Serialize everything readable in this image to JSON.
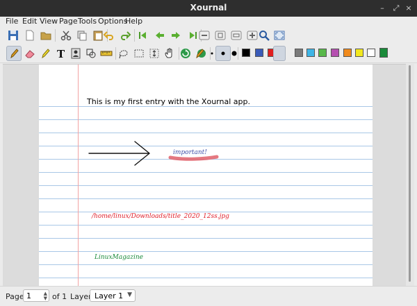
{
  "window": {
    "title": "Xournal",
    "minimize": "–",
    "restore": "⤢",
    "close": "×"
  },
  "menu": [
    "File",
    "Edit",
    "View",
    "Page",
    "Tools",
    "Options",
    "Help"
  ],
  "toolbar1": [
    "save-icon",
    "new-page-icon",
    "open-icon",
    "cut-icon",
    "copy-icon",
    "paste-icon",
    "undo-icon",
    "redo-icon",
    "first-page-icon",
    "previous-page-icon",
    "next-page-icon",
    "last-page-icon",
    "zoom-out-icon",
    "zoom-100-icon",
    "zoom-fit-icon",
    "zoom-in-icon",
    "search-icon",
    "fullscreen-icon"
  ],
  "toolbar2": [
    "pen-icon",
    "eraser-icon",
    "highlighter-icon",
    "text-icon",
    "image-icon",
    "shape-recognizer-icon",
    "ruler-icon",
    "select-region-icon",
    "select-rectangle-icon",
    "vertical-space-icon",
    "hand-icon",
    "default-tool-icon",
    "default-pen-icon"
  ],
  "thickness": [
    "fine",
    "medium",
    "thick"
  ],
  "colors": [
    "#000000",
    "#3a5bb8",
    "#e02020",
    "#1a8a3a",
    "#7a7a7a",
    "#3fb5e6",
    "#59b84a",
    "#b54fb0",
    "#f08a1c",
    "#f2e81e",
    "#ffffff",
    "#1a8a3a"
  ],
  "active_color": "#1a8a3a",
  "document": {
    "typed_text": "This is my first entry with the Xournal app.",
    "hand_important": "important!",
    "hand_path": "/home/linux/Downloads/title_2020_12ss.jpg",
    "hand_brand": "LinuxMagazine",
    "ink_blue": "#3d4fa8",
    "ink_red": "#e0202a",
    "ink_green": "#1a8a3a",
    "highlight": "#e0606a"
  },
  "status": {
    "page_label": "Page",
    "page_value": "1",
    "of_label": "of 1",
    "layer_label": "Layer:",
    "layer_value": "Layer 1"
  }
}
